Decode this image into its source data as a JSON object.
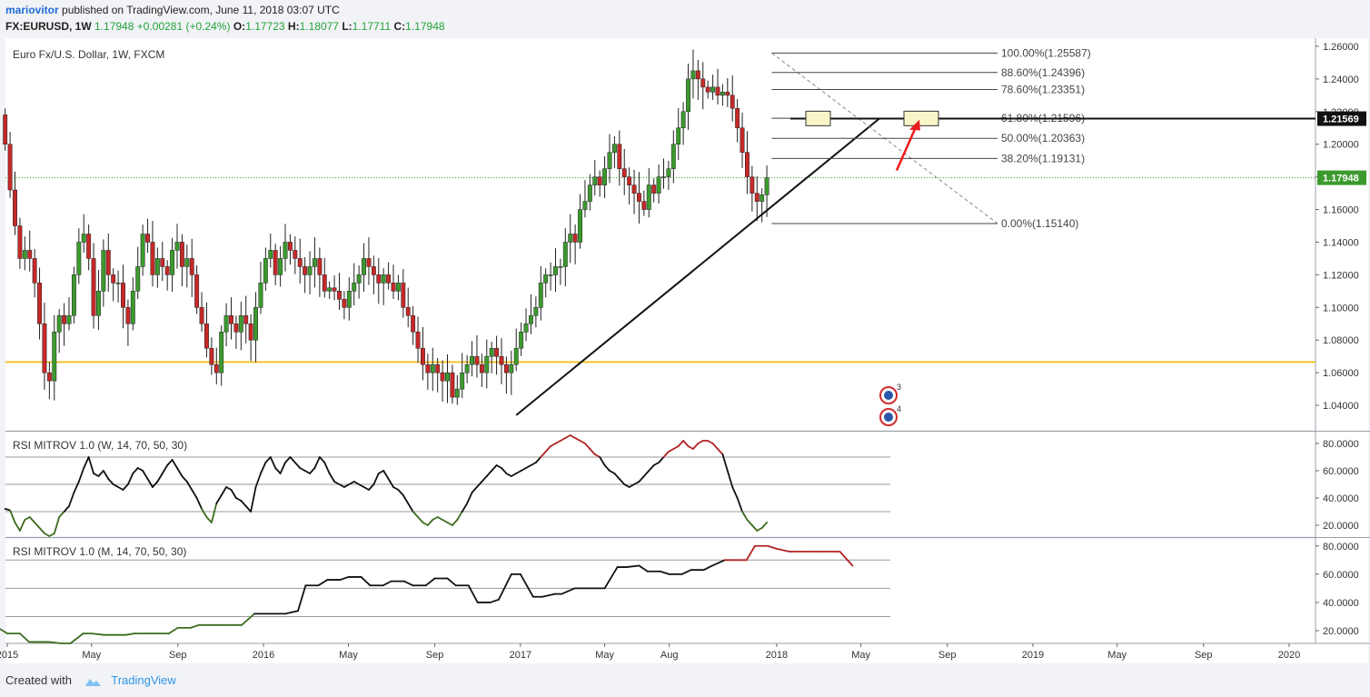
{
  "header": {
    "author": "mariovitor",
    "published_text": "published on TradingView.com, June 11, 2018 03:07 UTC",
    "symbol": "FX:EURUSD, 1W",
    "last": "1.17948",
    "change": "+0.00281 (+0.24%)",
    "o_label": "O:",
    "o": "1.17723",
    "h_label": "H:",
    "h": "1.18077",
    "l_label": "L:",
    "l": "1.17711",
    "c_label": "C:",
    "c": "1.17948"
  },
  "footer": {
    "created_with": "Created with",
    "brand": "TradingView"
  },
  "colors": {
    "up": "#3c9a2e",
    "down": "#c62828",
    "rsi": "#111111",
    "rsi_ob": "#b22222",
    "rsi_os": "#3d6b1e",
    "support": "#f5b800",
    "arrow": "#ee1c1c"
  },
  "chart_data": [
    {
      "type": "candlestick",
      "title": "Euro Fx/U.S. Dollar, 1W, FXCM",
      "y_axis_ticks": [
        "1.26000",
        "1.24000",
        "1.22000",
        "1.20000",
        "1.18000",
        "1.16000",
        "1.14000",
        "1.12000",
        "1.10000",
        "1.08000",
        "1.06000",
        "1.04000"
      ],
      "ylim": [
        1.025,
        1.265
      ],
      "x_tick_labels": [
        "2015",
        "May",
        "Sep",
        "2016",
        "May",
        "Sep",
        "2017",
        "May",
        "Aug",
        "2018",
        "May",
        "Sep",
        "2019",
        "May",
        "Sep",
        "2020"
      ],
      "last_price": "1.17948",
      "price_tag": "1.21569",
      "horizontal_support": 1.0665,
      "trendline": [
        [
          "2016-12-26",
          1.034
        ],
        [
          "2018-05-28",
          1.216
        ]
      ],
      "target_box_price": 1.2158,
      "event_icons": [
        "3",
        "4"
      ],
      "fibonacci": {
        "from": 1.25587,
        "to": 1.1514,
        "levels": [
          {
            "label": "100.00%(1.25587)",
            "value": 1.25587
          },
          {
            "label": "88.60%(1.24396)",
            "value": 1.24396
          },
          {
            "label": "78.60%(1.23351)",
            "value": 1.23351
          },
          {
            "label": "61.80%(1.21596)",
            "value": 1.21596
          },
          {
            "label": "50.00%(1.20363)",
            "value": 1.20363
          },
          {
            "label": "38.20%(1.19131)",
            "value": 1.19131
          },
          {
            "label": "0.00%(1.15140)",
            "value": 1.1514
          }
        ]
      },
      "close": [
        1.2,
        1.172,
        1.15,
        1.13,
        1.135,
        1.13,
        1.115,
        1.09,
        1.06,
        1.055,
        1.085,
        1.095,
        1.09,
        1.095,
        1.12,
        1.14,
        1.145,
        1.13,
        1.095,
        1.11,
        1.135,
        1.12,
        1.115,
        1.115,
        1.1,
        1.09,
        1.11,
        1.125,
        1.145,
        1.14,
        1.12,
        1.13,
        1.125,
        1.12,
        1.135,
        1.14,
        1.125,
        1.13,
        1.12,
        1.1,
        1.09,
        1.075,
        1.065,
        1.06,
        1.085,
        1.095,
        1.09,
        1.085,
        1.095,
        1.09,
        1.08,
        1.1,
        1.115,
        1.13,
        1.135,
        1.12,
        1.13,
        1.14,
        1.135,
        1.13,
        1.125,
        1.12,
        1.125,
        1.13,
        1.12,
        1.11,
        1.112,
        1.11,
        1.105,
        1.1,
        1.11,
        1.115,
        1.12,
        1.13,
        1.125,
        1.12,
        1.115,
        1.12,
        1.115,
        1.11,
        1.115,
        1.1,
        1.095,
        1.085,
        1.075,
        1.065,
        1.06,
        1.065,
        1.06,
        1.055,
        1.06,
        1.045,
        1.05,
        1.06,
        1.065,
        1.07,
        1.065,
        1.06,
        1.07,
        1.075,
        1.07,
        1.065,
        1.06,
        1.065,
        1.075,
        1.085,
        1.09,
        1.095,
        1.1,
        1.115,
        1.12,
        1.12,
        1.125,
        1.125,
        1.14,
        1.145,
        1.14,
        1.16,
        1.165,
        1.175,
        1.18,
        1.175,
        1.185,
        1.195,
        1.2,
        1.185,
        1.18,
        1.175,
        1.17,
        1.165,
        1.16,
        1.175,
        1.17,
        1.18,
        1.18,
        1.185,
        1.2,
        1.21,
        1.22,
        1.24,
        1.245,
        1.24,
        1.235,
        1.232,
        1.235,
        1.23,
        1.232,
        1.23,
        1.222,
        1.21,
        1.195,
        1.18,
        1.17,
        1.165,
        1.169,
        1.1795
      ]
    },
    {
      "type": "line",
      "title": "RSI MITROV 1.0 (W, 14, 70, 50, 30)",
      "y_axis_ticks": [
        "80.0000",
        "60.0000",
        "40.0000",
        "20.0000"
      ],
      "ylim": [
        12,
        88
      ],
      "levels": [
        70,
        50,
        30
      ],
      "values": [
        32,
        31,
        22,
        16,
        24,
        26,
        22,
        18,
        14,
        12,
        14,
        26,
        30,
        34,
        44,
        52,
        62,
        70,
        58,
        56,
        60,
        54,
        50,
        48,
        46,
        50,
        58,
        62,
        60,
        54,
        48,
        52,
        58,
        64,
        68,
        62,
        56,
        52,
        46,
        40,
        32,
        26,
        22,
        36,
        42,
        48,
        46,
        40,
        38,
        34,
        30,
        48,
        58,
        66,
        70,
        62,
        58,
        66,
        70,
        66,
        62,
        60,
        58,
        62,
        70,
        66,
        58,
        52,
        50,
        48,
        50,
        52,
        50,
        48,
        46,
        50,
        58,
        60,
        54,
        48,
        46,
        42,
        36,
        30,
        26,
        22,
        20,
        24,
        26,
        24,
        22,
        20,
        24,
        30,
        36,
        44,
        48,
        52,
        56,
        60,
        64,
        62,
        58,
        56,
        58,
        60,
        62,
        64,
        66,
        70,
        74,
        78,
        80,
        82,
        84,
        86,
        84,
        82,
        80,
        76,
        72,
        70,
        64,
        60,
        58,
        54,
        50,
        48,
        50,
        52,
        56,
        60,
        64,
        66,
        70,
        74,
        76,
        78,
        82,
        78,
        76,
        80,
        82,
        82,
        80,
        76,
        72,
        60,
        48,
        40,
        30,
        24,
        20,
        16,
        18,
        22
      ]
    },
    {
      "type": "line",
      "title": "RSI MITROV 1.0 (M, 14, 70, 50, 30)",
      "y_axis_ticks": [
        "80.0000",
        "60.0000",
        "40.0000",
        "20.0000"
      ],
      "ylim": [
        11,
        85
      ],
      "levels": [
        70,
        50,
        30
      ],
      "values": [
        28,
        22,
        18,
        18,
        12,
        12,
        12,
        11,
        11,
        18,
        18,
        17,
        17,
        17,
        18,
        18,
        18,
        18,
        22,
        22,
        24,
        24,
        24,
        24,
        24,
        32,
        32,
        32,
        32,
        34,
        52,
        52,
        56,
        56,
        58,
        58,
        52,
        52,
        55,
        55,
        52,
        52,
        57,
        57,
        52,
        52,
        40,
        40,
        42,
        60,
        60,
        44,
        44,
        46,
        46,
        50,
        50,
        50,
        50,
        65,
        65,
        66,
        62,
        62,
        60,
        60,
        63,
        63,
        66,
        70,
        70,
        70,
        80,
        80,
        78,
        76,
        76,
        76,
        76,
        76,
        76,
        66
      ]
    }
  ]
}
